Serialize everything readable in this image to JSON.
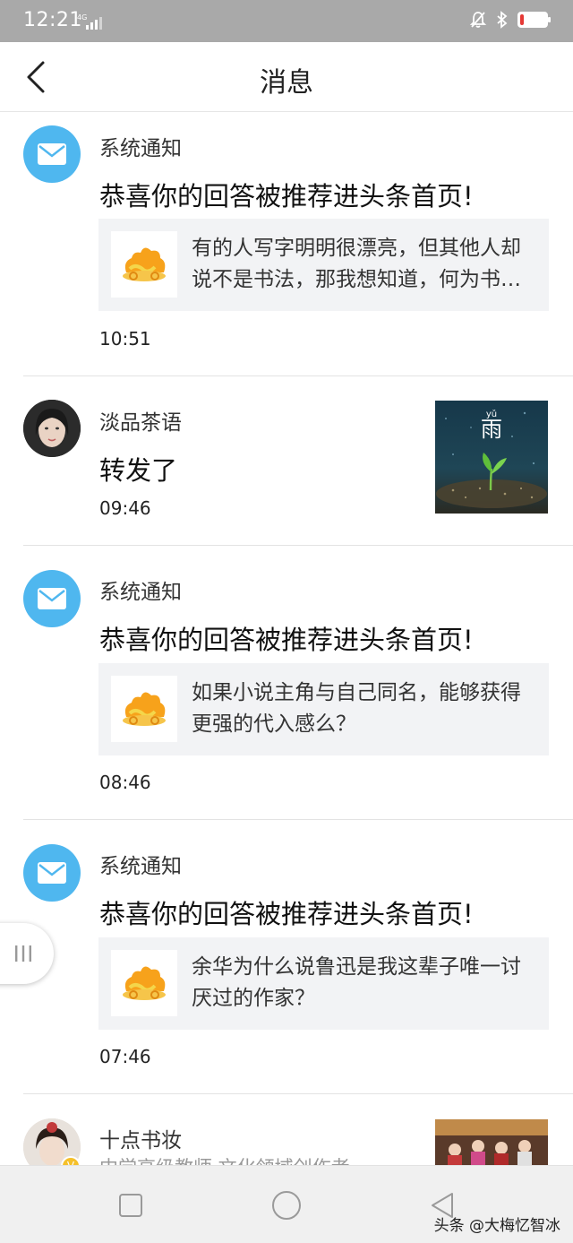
{
  "status_bar": {
    "time": "12:21",
    "network": "4G",
    "battery_level": 0.15,
    "battery_color": "#e53935"
  },
  "header": {
    "title": "消息",
    "back_icon": "chevron-left-icon"
  },
  "messages": [
    {
      "type": "system",
      "sender": "系统通知",
      "text": "恭喜你的回答被推荐进头条首页!",
      "quote": "有的人写字明明很漂亮，但其他人却说不是书法，那我想知道，何为书法？",
      "time": "10:51"
    },
    {
      "type": "user",
      "sender": "淡品茶语",
      "text": "转发了",
      "time": "09:46",
      "thumb_char": "雨",
      "thumb_pinyin": "yǔ"
    },
    {
      "type": "system",
      "sender": "系统通知",
      "text": "恭喜你的回答被推荐进头条首页!",
      "quote": "如果小说主角与自己同名，能够获得更强的代入感么？",
      "time": "08:46"
    },
    {
      "type": "system",
      "sender": "系统通知",
      "text": "恭喜你的回答被推荐进头条首页!",
      "quote": "余华为什么说鲁迅是我这辈子唯一讨厌过的作家？",
      "time": "07:46"
    },
    {
      "type": "user",
      "sender": "十点书妆",
      "subtitle": "中学高级教师 文化领域创作者"
    }
  ],
  "nav": {
    "recent": "square-icon",
    "home": "circle-icon",
    "back": "triangle-back-icon"
  },
  "watermark": "头条 @大梅忆智冰",
  "colors": {
    "mail_blue": "#4fb7ef",
    "card_bg": "#f2f3f5",
    "status_bar": "#a9a9a9"
  }
}
